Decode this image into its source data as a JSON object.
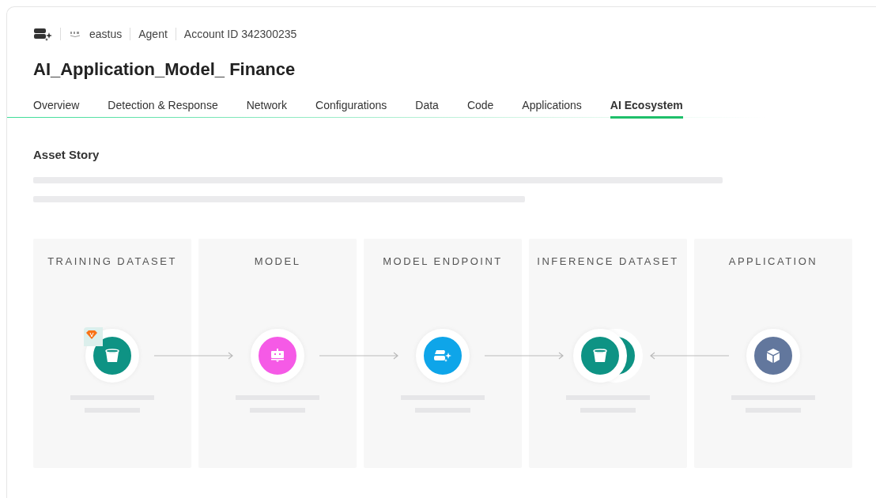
{
  "header": {
    "region": "eastus",
    "agent": "Agent",
    "account": "Account ID 342300235"
  },
  "title": "AI_Application_Model_ Finance",
  "tabs": [
    {
      "label": "Overview",
      "selected": false
    },
    {
      "label": "Detection & Response",
      "selected": false
    },
    {
      "label": "Network",
      "selected": false
    },
    {
      "label": "Configurations",
      "selected": false
    },
    {
      "label": "Data",
      "selected": false
    },
    {
      "label": "Code",
      "selected": false
    },
    {
      "label": "Applications",
      "selected": false
    },
    {
      "label": "AI Ecosystem",
      "selected": true
    }
  ],
  "section_title": "Asset Story",
  "stages": [
    {
      "label": "TRAINING DATASET",
      "kind": "dataset",
      "color": "#0e9384",
      "stacked": false,
      "badge": true,
      "arrow_right": true,
      "arrow_left": false
    },
    {
      "label": "MODEL",
      "kind": "model",
      "color": "#f55ae6",
      "stacked": false,
      "badge": false,
      "arrow_right": true,
      "arrow_left": false
    },
    {
      "label": "MODEL ENDPOINT",
      "kind": "endpoint",
      "color": "#0ea5e9",
      "stacked": false,
      "badge": false,
      "arrow_right": true,
      "arrow_left": false
    },
    {
      "label": "INFERENCE DATASET",
      "kind": "dataset",
      "color": "#0e9384",
      "stacked": true,
      "badge": false,
      "arrow_right": false,
      "arrow_left": true
    },
    {
      "label": "APPLICATION",
      "kind": "application",
      "color": "#62779d",
      "stacked": false,
      "badge": false,
      "arrow_right": false,
      "arrow_left": false
    }
  ]
}
